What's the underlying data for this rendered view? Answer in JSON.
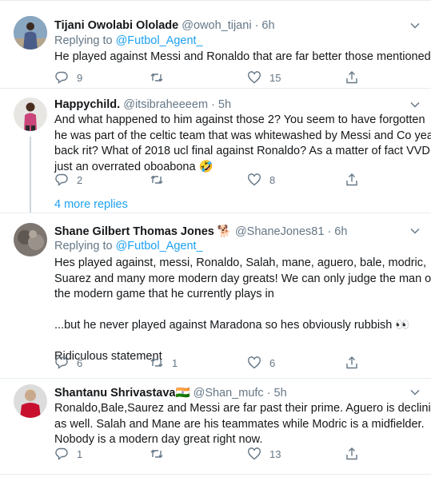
{
  "tweets": [
    {
      "name": "Tijani Owolabi Ololade",
      "handle": "@owoh_tijani",
      "time": "· 6h",
      "replying_prefix": "Replying to ",
      "replying_to": "@Futbol_Agent_",
      "lines": [
        "He played against Messi and Ronaldo that are far better those mentioned"
      ],
      "replies": "9",
      "retweets": "",
      "likes": "15"
    },
    {
      "name": "Happychild.",
      "handle": "@itsibraheeeem",
      "time": "· 5h",
      "lines": [
        "And what  happened to him against those  2? You seem to have  forgotten",
        "he was part of the celtic team that  was whitewashed by Messi and Co years",
        "back rit? What  of 2018 ucl final against Ronaldo? As a matter of fact  VVD is",
        "just  an overrated  oboabona 🤣"
      ],
      "replies": "2",
      "retweets": "",
      "likes": "8"
    },
    {
      "name": "Shane Gilbert Thomas Jones 🐕",
      "handle": "@ShaneJones81",
      "time": "· 6h",
      "replying_prefix": "Replying to ",
      "replying_to": "@Futbol_Agent_",
      "lines": [
        "Hes played against, messi, Ronaldo, Salah, mane, aguero, bale, modric,",
        "Suarez and many more modern day greats! We can only judge the man on",
        "the modern game that he currently plays in",
        "",
        "...but he never played against Maradona so hes obviously rubbish 👀",
        "",
        "Ridiculous statement"
      ],
      "replies": "6",
      "retweets": "1",
      "likes": "6"
    },
    {
      "name": "Shantanu Shrivastava🇮🇳",
      "handle": "@Shan_mufc",
      "time": "· 5h",
      "lines": [
        "Ronaldo,Bale,Saurez and Messi are far past their prime. Aguero is declining",
        "as well. Salah and Mane are his teammates while Modric is a midfielder.",
        "Nobody is a modern day great right now."
      ],
      "replies": "1",
      "retweets": "",
      "likes": "13"
    }
  ],
  "more_replies": "4 more replies",
  "icons": [
    "chevron-down-icon",
    "reply-icon",
    "retweet-icon",
    "like-icon",
    "share-icon"
  ],
  "colors": {
    "link": "#1da1f2",
    "secondary": "#657786",
    "divider": "#e6ecf0"
  }
}
